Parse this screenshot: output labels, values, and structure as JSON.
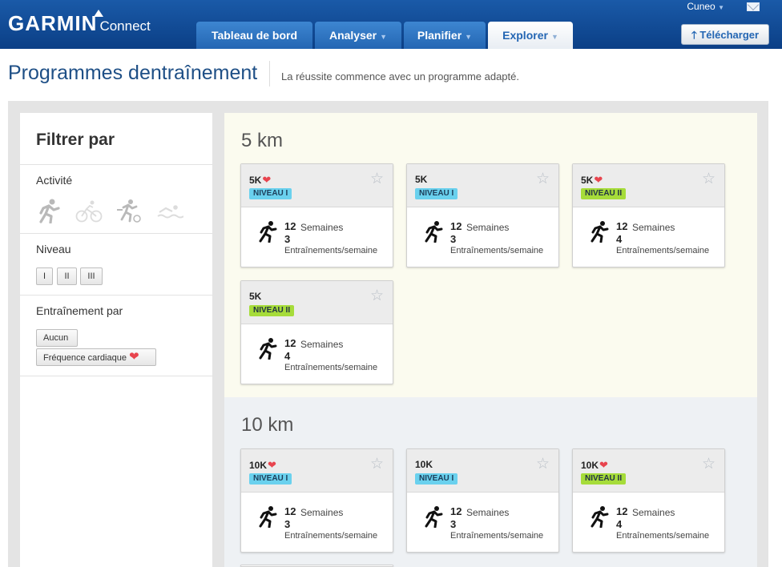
{
  "header": {
    "brand": "GARMIN",
    "brand_sub": "Connect",
    "user": "Cuneo",
    "tabs": [
      {
        "label": "Tableau de bord",
        "caret": false
      },
      {
        "label": "Analyser",
        "caret": true
      },
      {
        "label": "Planifier",
        "caret": true
      },
      {
        "label": "Explorer",
        "caret": true
      }
    ],
    "upload_label": "Télécharger"
  },
  "page": {
    "title": "Programmes dentraînement",
    "subtitle": "La réussite commence avec un programme adapté."
  },
  "sidebar": {
    "title": "Filtrer par",
    "activity_label": "Activité",
    "level_label": "Niveau",
    "levels": [
      "I",
      "II",
      "III"
    ],
    "training_label": "Entraînement par",
    "training_options": [
      "Aucun",
      "Fréquence cardiaque"
    ]
  },
  "sections": [
    {
      "title": "5 km",
      "cards": [
        {
          "name": "5K",
          "heart": true,
          "level": "NIVEAU I",
          "weeks": "12",
          "weeks_label": "Semaines",
          "sessions": "3",
          "sessions_label": "Entraînements/semaine"
        },
        {
          "name": "5K",
          "heart": false,
          "level": "NIVEAU I",
          "weeks": "12",
          "weeks_label": "Semaines",
          "sessions": "3",
          "sessions_label": "Entraînements/semaine"
        },
        {
          "name": "5K",
          "heart": true,
          "level": "NIVEAU II",
          "weeks": "12",
          "weeks_label": "Semaines",
          "sessions": "4",
          "sessions_label": "Entraînements/semaine"
        },
        {
          "name": "5K",
          "heart": false,
          "level": "NIVEAU II",
          "weeks": "12",
          "weeks_label": "Semaines",
          "sessions": "4",
          "sessions_label": "Entraînements/semaine"
        }
      ]
    },
    {
      "title": "10 km",
      "cards": [
        {
          "name": "10K",
          "heart": true,
          "level": "NIVEAU I",
          "weeks": "12",
          "weeks_label": "Semaines",
          "sessions": "3",
          "sessions_label": "Entraînements/semaine"
        },
        {
          "name": "10K",
          "heart": false,
          "level": "NIVEAU I",
          "weeks": "12",
          "weeks_label": "Semaines",
          "sessions": "3",
          "sessions_label": "Entraînements/semaine"
        },
        {
          "name": "10K",
          "heart": true,
          "level": "NIVEAU II",
          "weeks": "12",
          "weeks_label": "Semaines",
          "sessions": "4",
          "sessions_label": "Entraînements/semaine"
        }
      ]
    }
  ],
  "colors": {
    "header_dark": "#0b3f86",
    "tab_blue": "#2466b3",
    "level1": "#6ad1ee",
    "level2": "#a6dc3a",
    "heart": "#e8444e"
  }
}
